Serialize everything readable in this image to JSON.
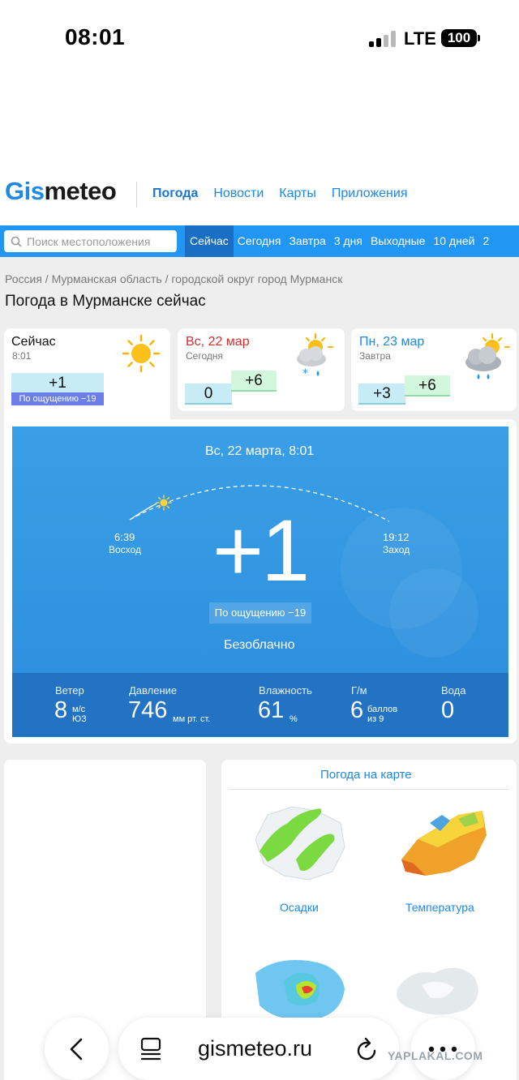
{
  "status_bar": {
    "time": "08:01",
    "network": "LTE",
    "battery": "100"
  },
  "header": {
    "logo_part1": "Gis",
    "logo_part2": "meteo",
    "nav": [
      "Погода",
      "Новости",
      "Карты",
      "Приложения"
    ],
    "active_nav": "Погода"
  },
  "search": {
    "placeholder": "Поиск местоположения"
  },
  "tabs": [
    "Сейчас",
    "Сегодня",
    "Завтра",
    "3 дня",
    "Выходные",
    "10 дней",
    "2"
  ],
  "active_tab": "Сейчас",
  "breadcrumb": "Россия / Мурманская область / городской округ город Мурманск",
  "page_title": "Погода в Мурманске сейчас",
  "now_card": {
    "title": "Сейчас",
    "time": "8:01",
    "temp": "+1",
    "feels": "По ощущению −19",
    "icon": "sun-icon"
  },
  "today_card": {
    "date": "Вс, 22 мар",
    "label": "Сегодня",
    "temp_min": "0",
    "temp_max": "+6",
    "icon": "sun-cloud-snow-rain-icon"
  },
  "tomorrow_card": {
    "date": "Пн, 23 мар",
    "label": "Завтра",
    "temp_min": "+3",
    "temp_max": "+6",
    "icon": "sun-cloud-rain-icon"
  },
  "current": {
    "datetime": "Вс, 22 марта, 8:01",
    "sunrise_time": "6:39",
    "sunrise_label": "Восход",
    "sunset_time": "19:12",
    "sunset_label": "Заход",
    "temp": "+1",
    "feels": "По ощущению −19",
    "condition": "Безоблачно"
  },
  "stats": {
    "wind": {
      "label": "Ветер",
      "value": "8",
      "unit1": "м/с",
      "unit2": "ЮЗ"
    },
    "pressure": {
      "label": "Давление",
      "value": "746",
      "unit": "мм рт. ст."
    },
    "humidity": {
      "label": "Влажность",
      "value": "61",
      "unit": "%"
    },
    "geomag": {
      "label": "Г/м",
      "value": "6",
      "unit1": "баллов",
      "unit2": "из 9"
    },
    "water": {
      "label": "Вода",
      "value": "0"
    }
  },
  "map_section": {
    "title": "Погода на карте",
    "items": [
      "Осадки",
      "Температура"
    ]
  },
  "browser": {
    "url": "gismeteo.ru"
  },
  "watermark": "YAPLAKAL.COM",
  "colors": {
    "brand_blue": "#2196f3",
    "active_tab": "#1a6fc4",
    "today_red": "#d32f2f",
    "sky": "#2c8ddd",
    "stats_bar": "#2373c4"
  }
}
